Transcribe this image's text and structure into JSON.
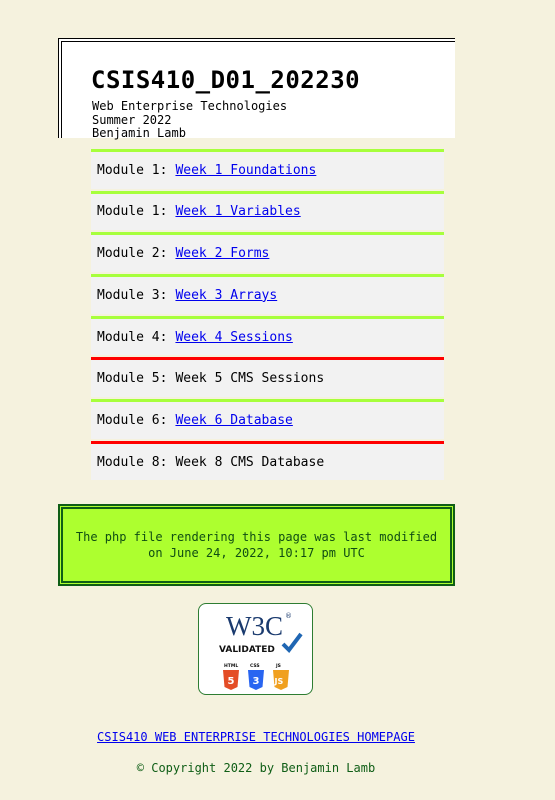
{
  "header": {
    "title": "CSIS410_D01_202230",
    "subtitle": "Web Enterprise Technologies",
    "term": "Summer 2022",
    "instructor": "Benjamin Lamb"
  },
  "modules": [
    {
      "prefix": "Module 1:",
      "label": "Week 1 Foundations",
      "linked": true,
      "status": "green"
    },
    {
      "prefix": "Module 1:",
      "label": "Week 1 Variables",
      "linked": true,
      "status": "green"
    },
    {
      "prefix": "Module 2:",
      "label": "Week 2 Forms",
      "linked": true,
      "status": "green"
    },
    {
      "prefix": "Module 3:",
      "label": "Week 3 Arrays",
      "linked": true,
      "status": "green"
    },
    {
      "prefix": "Module 4:",
      "label": "Week 4 Sessions",
      "linked": true,
      "status": "green"
    },
    {
      "prefix": "Module 5:",
      "label": "Week 5 CMS Sessions",
      "linked": false,
      "status": "red"
    },
    {
      "prefix": "Module 6:",
      "label": "Week 6 Database",
      "linked": true,
      "status": "green"
    },
    {
      "prefix": "Module 8:",
      "label": "Week 8 CMS Database",
      "linked": false,
      "status": "red"
    }
  ],
  "modified_notice": "The php file rendering this page was last modified on June 24, 2022, 10:17 pm UTC",
  "badge": {
    "logo": "W3C",
    "registered": "®",
    "label": "VALIDATED",
    "checkmark_icon": "checkmark-icon",
    "items": [
      "HTML",
      "CSS",
      "JS"
    ],
    "numbers": [
      "5",
      "3",
      "JS"
    ]
  },
  "footer": {
    "homepage_link": "CSIS410 WEB ENTERPRISE TECHNOLOGIES HOMEPAGE",
    "copyright": "© Copyright 2022 by Benjamin Lamb"
  },
  "colors": {
    "background": "#f5f2de",
    "complete_border": "#a7ff3c",
    "incomplete_border": "#ff0000",
    "notice_bg": "#adff2f",
    "link": "#0000ee"
  }
}
